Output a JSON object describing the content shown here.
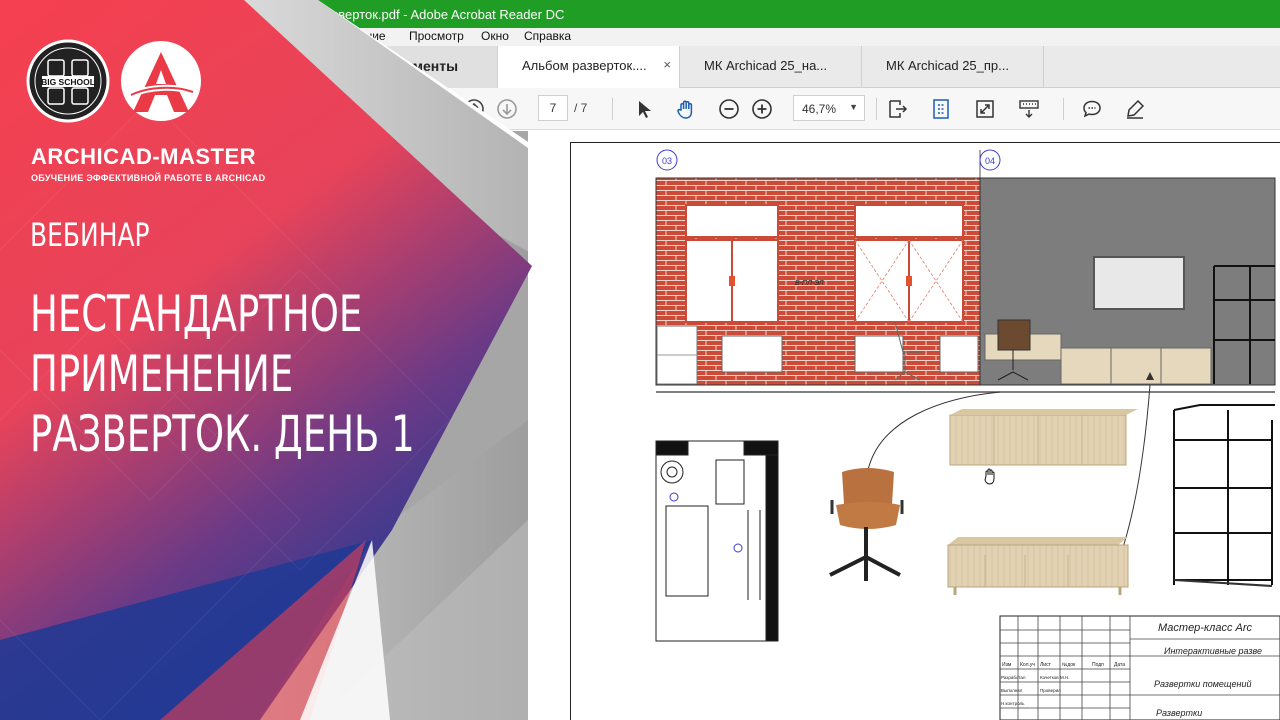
{
  "window": {
    "title": "разверток.pdf - Adobe Acrobat Reader DC",
    "menu": [
      "ование",
      "Просмотр",
      "Окно",
      "Справка"
    ]
  },
  "tabs": {
    "tools": "струменты",
    "items": [
      {
        "label": "Альбом разверток....",
        "close": "×"
      },
      {
        "label": "МК Archicad 25_на..."
      },
      {
        "label": "МК Archicad 25_пр..."
      }
    ]
  },
  "toolbar": {
    "page_current": "7",
    "page_total": "/ 7",
    "zoom": "46,7%",
    "zoom_caret": "▼"
  },
  "drawing": {
    "view_tag_left": "03",
    "view_tag_right": "04",
    "wall_label": "В-ПЛ-ЭЛ",
    "stamp": {
      "project": "Мастер-класс Arc",
      "subtitle": "Интерактивные разве",
      "sheet_name": "Развертки помещений",
      "last_row": "Развертки",
      "columns": [
        "Изм",
        "Кол.уч",
        "Лист",
        "№док",
        "Подп",
        "Дата"
      ],
      "people": [
        "Разработал",
        "Кочетков М.Н.",
        "Выполнил",
        "Проверил",
        "Н.контроль"
      ]
    }
  },
  "banner": {
    "school_logo_text": "BIG SCHOOL",
    "brand": "ARCHICAD-MASTER",
    "brand_subtitle": "ОБУЧЕНИЕ ЭФФЕКТИВНОЙ РАБОТЕ В ARCHICAD",
    "kicker": "ВЕБИНАР",
    "headline": [
      "НЕСТАНДАРТНОЕ",
      "ПРИМЕНЕНИЕ",
      "РАЗВЕРТОК. ДЕНЬ 1"
    ]
  },
  "colors": {
    "titlebar": "#1f9d24",
    "banner_red": "#f5404f",
    "banner_blue": "#1f3a94",
    "brick": "#c94a36",
    "wall_gray": "#7d7d7d"
  }
}
